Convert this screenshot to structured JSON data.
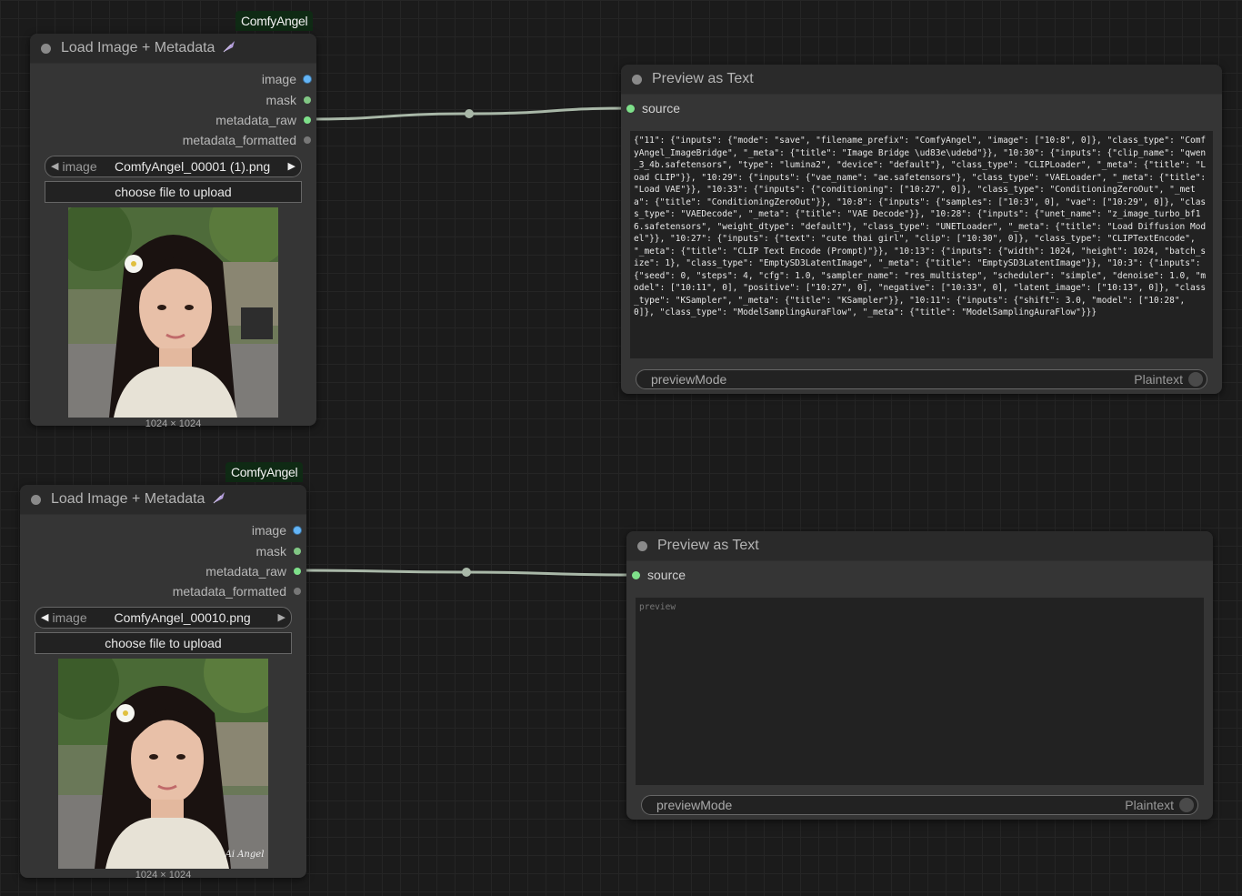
{
  "nodes": {
    "load1": {
      "badge": "ComfyAngel",
      "title": "Load Image + Metadata",
      "outputs": [
        "image",
        "mask",
        "metadata_raw",
        "metadata_formatted"
      ],
      "combo_label": "image",
      "combo_value": "ComfyAngel_00001 (1).png",
      "upload_label": "choose file to upload",
      "image_dims": "1024 × 1024"
    },
    "load2": {
      "badge": "ComfyAngel",
      "title": "Load Image + Metadata",
      "outputs": [
        "image",
        "mask",
        "metadata_raw",
        "metadata_formatted"
      ],
      "combo_label": "image",
      "combo_value": "ComfyAngel_00010.png",
      "upload_label": "choose file to upload",
      "image_dims": "1024 × 1024"
    },
    "preview1": {
      "title": "Preview as Text",
      "input": "source",
      "text": "{\"11\": {\"inputs\": {\"mode\": \"save\", \"filename_prefix\": \"ComfyAngel\", \"image\": [\"10:8\", 0]}, \"class_type\": \"ComfyAngel_ImageBridge\", \"_meta\": {\"title\": \"Image Bridge \\ud83e\\udebd\"}}, \"10:30\": {\"inputs\": {\"clip_name\": \"qwen_3_4b.safetensors\", \"type\": \"lumina2\", \"device\": \"default\"}, \"class_type\": \"CLIPLoader\", \"_meta\": {\"title\": \"Load CLIP\"}}, \"10:29\": {\"inputs\": {\"vae_name\": \"ae.safetensors\"}, \"class_type\": \"VAELoader\", \"_meta\": {\"title\": \"Load VAE\"}}, \"10:33\": {\"inputs\": {\"conditioning\": [\"10:27\", 0]}, \"class_type\": \"ConditioningZeroOut\", \"_meta\": {\"title\": \"ConditioningZeroOut\"}}, \"10:8\": {\"inputs\": {\"samples\": [\"10:3\", 0], \"vae\": [\"10:29\", 0]}, \"class_type\": \"VAEDecode\", \"_meta\": {\"title\": \"VAE Decode\"}}, \"10:28\": {\"inputs\": {\"unet_name\": \"z_image_turbo_bf16.safetensors\", \"weight_dtype\": \"default\"}, \"class_type\": \"UNETLoader\", \"_meta\": {\"title\": \"Load Diffusion Model\"}}, \"10:27\": {\"inputs\": {\"text\": \"cute thai girl\", \"clip\": [\"10:30\", 0]}, \"class_type\": \"CLIPTextEncode\", \"_meta\": {\"title\": \"CLIP Text Encode (Prompt)\"}}, \"10:13\": {\"inputs\": {\"width\": 1024, \"height\": 1024, \"batch_size\": 1}, \"class_type\": \"EmptySD3LatentImage\", \"_meta\": {\"title\": \"EmptySD3LatentImage\"}}, \"10:3\": {\"inputs\": {\"seed\": 0, \"steps\": 4, \"cfg\": 1.0, \"sampler_name\": \"res_multistep\", \"scheduler\": \"simple\", \"denoise\": 1.0, \"model\": [\"10:11\", 0], \"positive\": [\"10:27\", 0], \"negative\": [\"10:33\", 0], \"latent_image\": [\"10:13\", 0]}, \"class_type\": \"KSampler\", \"_meta\": {\"title\": \"KSampler\"}}, \"10:11\": {\"inputs\": {\"shift\": 3.0, \"model\": [\"10:28\", 0]}, \"class_type\": \"ModelSamplingAuraFlow\", \"_meta\": {\"title\": \"ModelSamplingAuraFlow\"}}}",
      "toggle_label": "previewMode",
      "toggle_value": "Plaintext"
    },
    "preview2": {
      "title": "Preview as Text",
      "input": "source",
      "placeholder": "preview",
      "toggle_label": "previewMode",
      "toggle_value": "Plaintext"
    }
  },
  "photo2_watermark": "Ai Angel",
  "colors": {
    "badge_bg": "#0f2a14",
    "wire": "#a9b8a8",
    "port_image": "#64b5f6",
    "port_green": "#7ee08a"
  }
}
